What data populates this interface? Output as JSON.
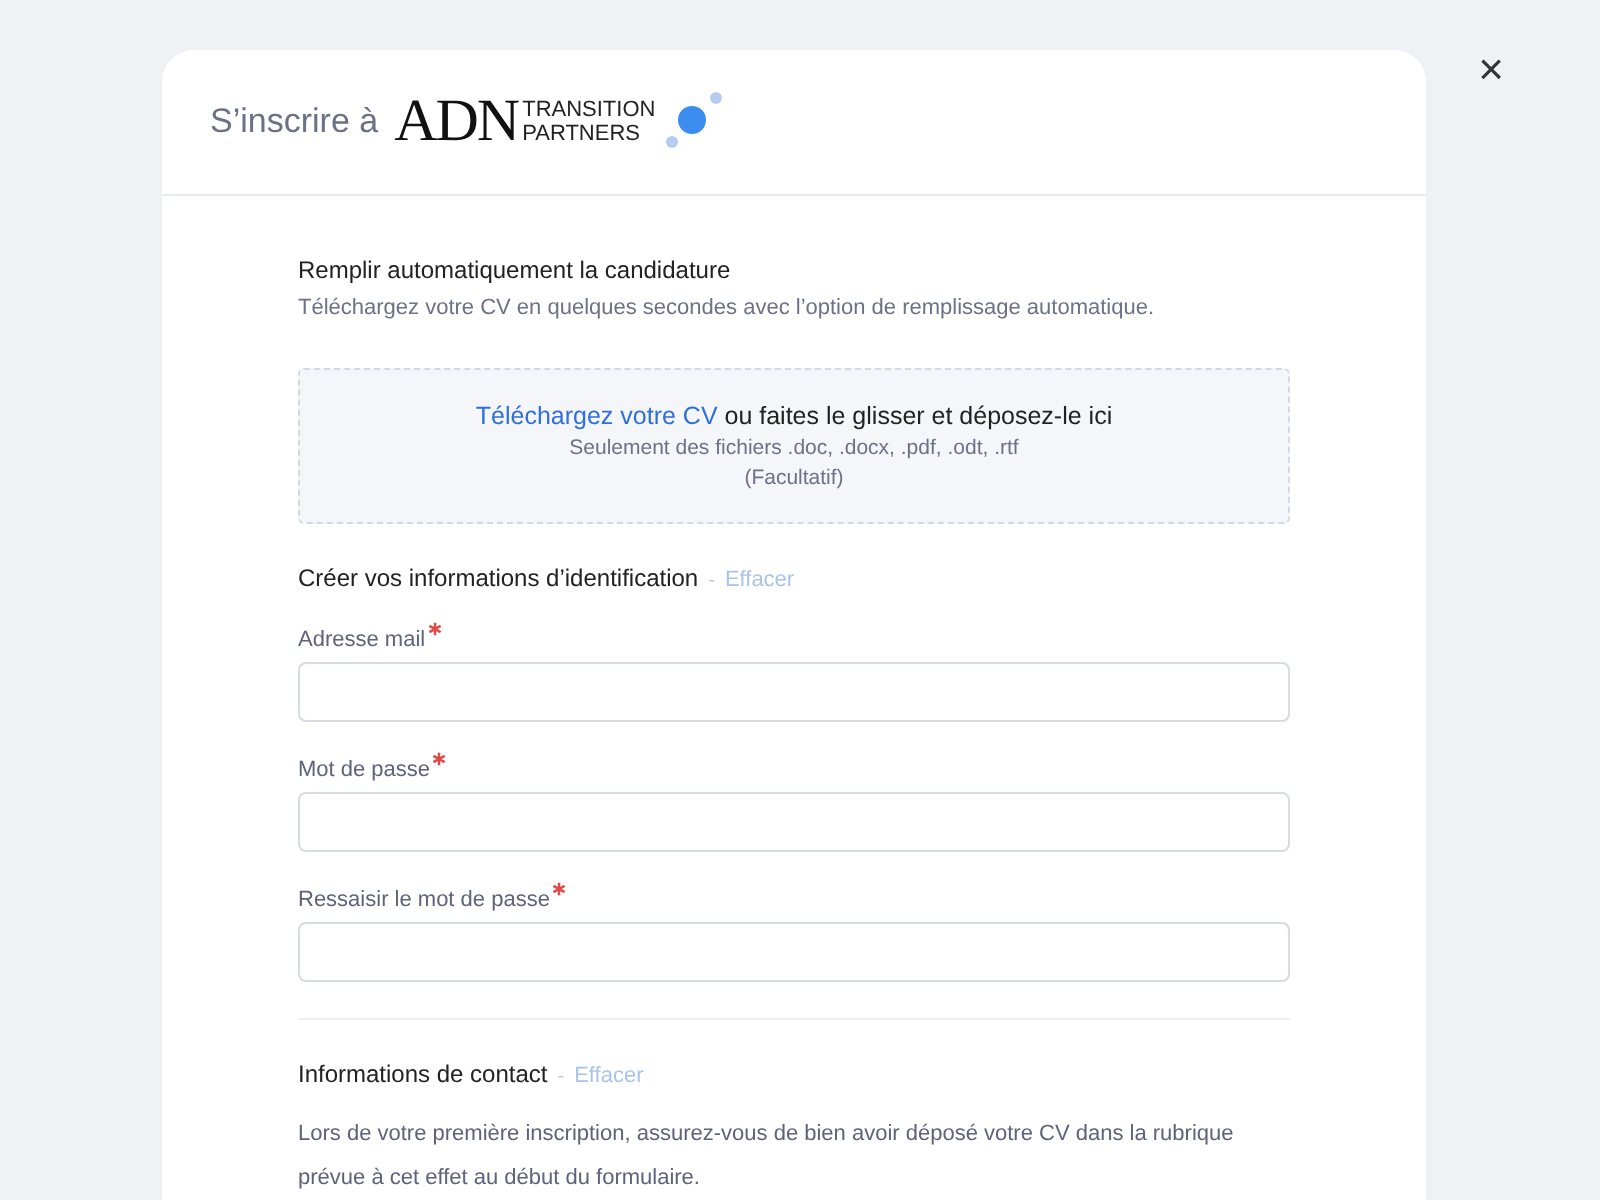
{
  "dialog": {
    "title": "S’inscrire à",
    "logo": {
      "main": "ADN",
      "line_1": "TRANSITION",
      "line_2": "PARTNERS"
    },
    "close": "×"
  },
  "autofill": {
    "title": "Remplir automatiquement la candidature",
    "description": "Téléchargez votre CV en quelques secondes avec l’option de remplissage automatique.",
    "dropzone": {
      "link": "Téléchargez votre CV",
      "text": " ou faites le glisser et déposez-le ici",
      "formats": "Seulement des fichiers .doc, .docx, .pdf, .odt, .rtf",
      "note": "(Facultatif)"
    }
  },
  "sections": [
    {
      "title": "Créer vos informations d’identification",
      "separator": "-",
      "clear": "Effacer",
      "fields": [
        {
          "label": "Adresse mail",
          "required": true
        },
        {
          "label": "Mot de passe",
          "required": true
        },
        {
          "label": "Ressaisir le mot de passe",
          "required": true
        }
      ]
    },
    {
      "title": "Informations de contact",
      "separator": "-",
      "clear": "Effacer",
      "note": "Lors de votre première inscription, assurez-vous de bien avoir déposé votre CV dans la rubrique prévue à cet effet au début du formulaire."
    }
  ]
}
